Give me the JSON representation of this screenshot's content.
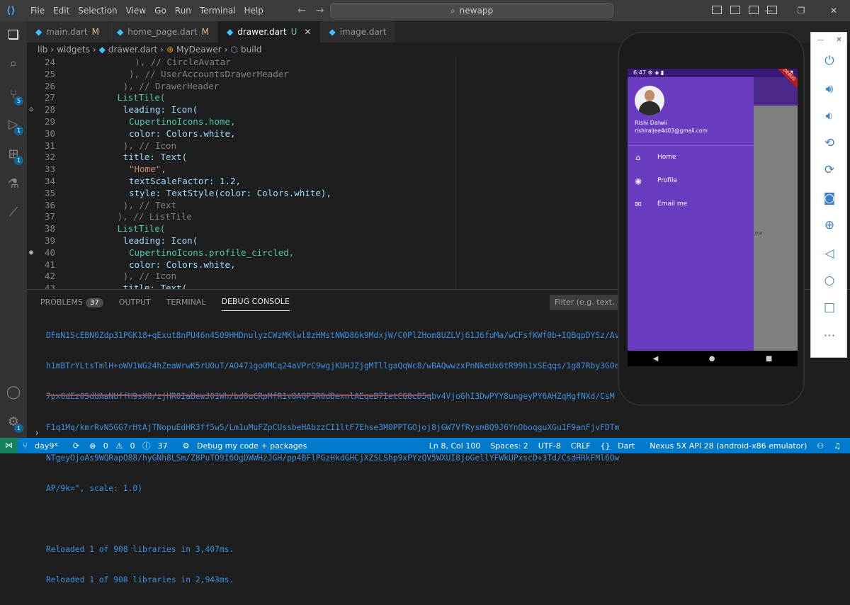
{
  "window": {
    "menu": [
      "File",
      "Edit",
      "Selection",
      "View",
      "Go",
      "Run",
      "Terminal",
      "Help"
    ],
    "search": "newapp"
  },
  "tabs": [
    {
      "name": "main.dart",
      "status": "M"
    },
    {
      "name": "home_page.dart",
      "status": "M"
    },
    {
      "name": "drawer.dart",
      "status": "U",
      "active": true
    },
    {
      "name": "image.dart",
      "status": ""
    }
  ],
  "breadcrumb": [
    "lib",
    "widgets",
    "drawer.dart",
    "MyDeawer",
    "build"
  ],
  "editor": {
    "lines": [
      {
        "n": "24",
        "text": "), // CircleAvatar"
      },
      {
        "n": "25",
        "text": "), // UserAccountsDrawerHeader"
      },
      {
        "n": "26",
        "text": "), // DrawerHeader"
      },
      {
        "n": "27",
        "text": "ListTile("
      },
      {
        "n": "28",
        "text": "leading: Icon("
      },
      {
        "n": "29",
        "text": "CupertinoIcons.home,"
      },
      {
        "n": "30",
        "text": "color: Colors.white,"
      },
      {
        "n": "31",
        "text": "), // Icon"
      },
      {
        "n": "32",
        "text": "title: Text("
      },
      {
        "n": "33",
        "text": "\"Home\","
      },
      {
        "n": "34",
        "text": "textScaleFactor: 1.2,"
      },
      {
        "n": "35",
        "text": "style: TextStyle(color: Colors.white),"
      },
      {
        "n": "36",
        "text": "), // Text"
      },
      {
        "n": "37",
        "text": "), // ListTile"
      },
      {
        "n": "38",
        "text": "ListTile("
      },
      {
        "n": "39",
        "text": "leading: Icon("
      },
      {
        "n": "40",
        "text": "CupertinoIcons.profile_circled,"
      },
      {
        "n": "41",
        "text": "color: Colors.white,"
      },
      {
        "n": "42",
        "text": "), // Icon"
      },
      {
        "n": "43",
        "text": "title: Text("
      }
    ]
  },
  "panel": {
    "tabs": [
      {
        "label": "PROBLEMS",
        "count": "37"
      },
      {
        "label": "OUTPUT"
      },
      {
        "label": "TERMINAL"
      },
      {
        "label": "DEBUG CONSOLE",
        "active": true
      }
    ],
    "filter_placeholder": "Filter (e.g. text, !excl",
    "output": [
      "DFmN1ScEBN0Zdp31PGK18+qExut8nPU46n4S09HHDnulyzCWzMKlwl8zHMstNWD86k9MdxjW/C0PlZHom8UZLVj61J6fuMa/wCFsfKWf0b+IQBqpDYSz/Av",
      "h1mBTrYLtsTmlH+oWV1WG24hZeaWrwK5rU0uT/AO471go0MCq24aVPrC9wgjKUHJZjgMTllgaQqWc8/wBAQwwzxPnNkeUx6tR99h1xSEqqs/1g87Rby3GOe",
      "7px0dEz0SdUAaNUffH9sX0/zjHR0IaBewJ01Wh/bd0uCRpMfR1v8AQP3R0dDexnlAEqeB7IetCG8cD5qbv4Vjo6hI3DwPYY8ungeyPY6AHZqHgfNXd/CsM",
      "F1q1Mq/kmrRvN5GG7rHtAjTNopuEdHR3ff5w5/Lm1uMuFZpCUssbeHAbzzCI1ltF7Ehse3M0PPTGOjoj8jGW7VfRysm8Q9J6YnOboqguXGu1F9anFjvFDTm",
      "NTgeyOjoAs9WQRapO88/hyGNh8LSm/Z8PuTO9I6OgDWWHzJGH/pp4BFlPGzHkdGHCjXZSLShp9xPYzQV5WXUI8joGellYFWkUPxscD+3Td/CsdHRkFMl6Ow",
      "AP/9k=\", scale: 1.0)"
    ],
    "reload1": "Reloaded 1 of 908 libraries in 3,407ms.",
    "reload2": "Reloaded 1 of 908 libraries in 2,943ms."
  },
  "statusbar": {
    "branch": "day9*",
    "errors": "0",
    "warnings": "0",
    "info": "37",
    "debug": "Debug my code + packages",
    "position": "Ln 8, Col 100",
    "spaces": "Spaces: 2",
    "encoding": "UTF-8",
    "eol": "CRLF",
    "language": "Dart",
    "device": "Nexus 5X API 28 (android-x86 emulator)"
  },
  "phone": {
    "time": "6:47",
    "user_name": "Rishi Dalwii",
    "user_email": "rishiraljee4d03@gmail.com",
    "items": [
      "Home",
      "Profile",
      "Email me"
    ],
    "hint": "cour",
    "debug_band": "DEBUG"
  }
}
